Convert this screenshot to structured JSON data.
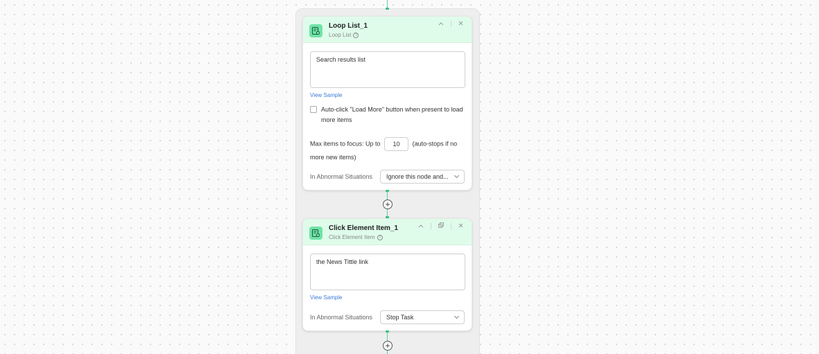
{
  "loop_node": {
    "title": "Loop List_1",
    "subtitle": "Loop List",
    "text_value": "Search results list",
    "view_sample": "View Sample",
    "checkbox_label": "Auto-click \"Load More\" button when present to load more items",
    "max_items_prefix": "Max items to focus: Up to",
    "max_items_value": "10",
    "max_items_suffix": "(auto-stops if no more new items)",
    "abnormal_label": "In Abnormal Situations",
    "abnormal_value": "Ignore this node and..."
  },
  "click_node": {
    "title": "Click Element Item_1",
    "subtitle": "Click Element Item",
    "text_value": "the News Tittle  link",
    "view_sample": "View Sample",
    "abnormal_label": "In Abnormal Situations",
    "abnormal_value": "Stop Task"
  },
  "icons": {
    "collapse": "chevron-up-icon",
    "close": "close-icon",
    "copy": "copy-icon",
    "add": "plus-icon",
    "node": "list-node-icon"
  },
  "colors": {
    "header_bg": "#dffcea",
    "node_icon": "#6fe3a7",
    "connector": "#5ccf9a",
    "link": "#3d7ad6"
  },
  "plus_symbol": "+"
}
